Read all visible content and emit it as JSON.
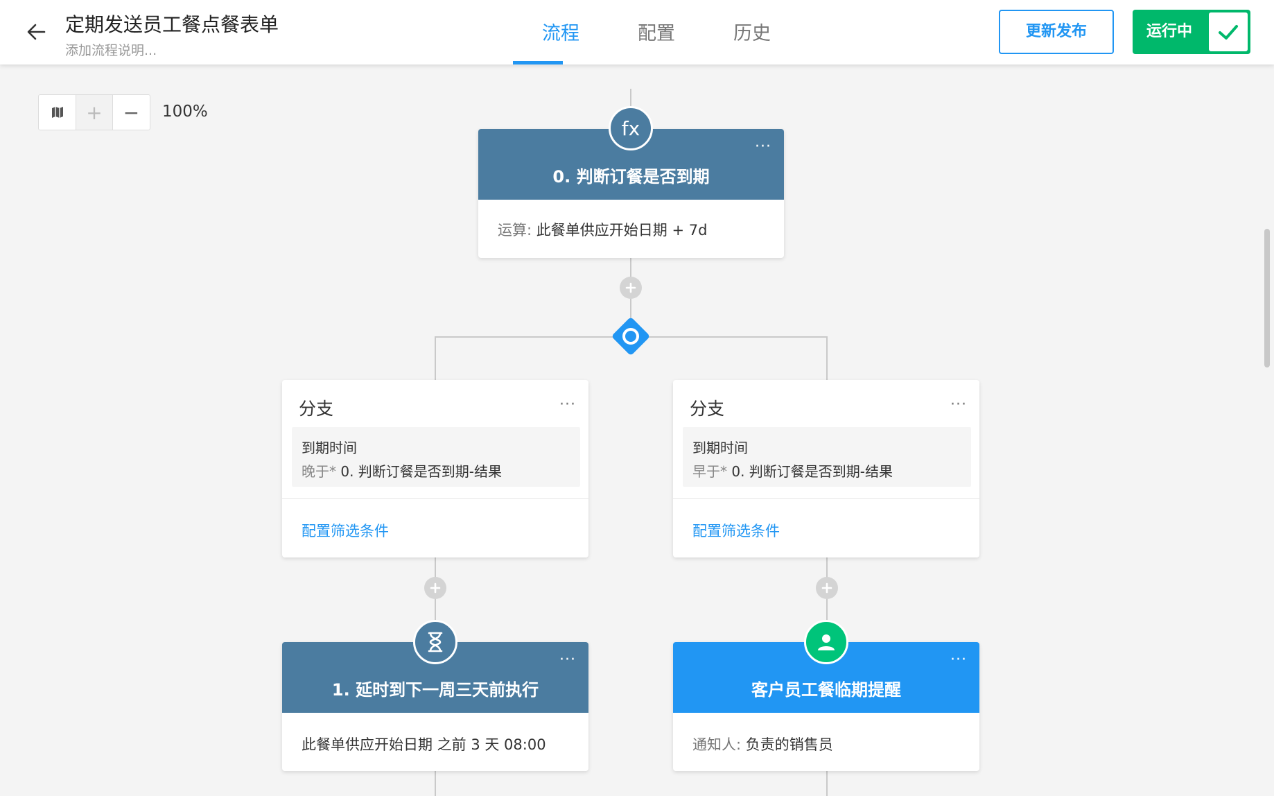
{
  "header": {
    "title": "定期发送员工餐点餐表单",
    "subtitle": "添加流程说明...",
    "tabs": [
      {
        "label": "流程"
      },
      {
        "label": "配置"
      },
      {
        "label": "历史"
      }
    ],
    "update_label": "更新发布",
    "run_label": "运行中"
  },
  "zoom": {
    "level": "100%",
    "plus": "+",
    "minus": "−"
  },
  "nodes": {
    "calc": {
      "icon_text": "fx",
      "title": "0. 判断订餐是否到期",
      "more": "···",
      "label": "运算:",
      "value": "此餐单供应开始日期 + 7d"
    },
    "branch_left": {
      "title": "分支",
      "more": "···",
      "field": "到期时间",
      "op": "晚于*",
      "target": "0. 判断订餐是否到期-结果",
      "link": "配置筛选条件"
    },
    "branch_right": {
      "title": "分支",
      "more": "···",
      "field": "到期时间",
      "op": "早于*",
      "target": "0. 判断订餐是否到期-结果",
      "link": "配置筛选条件"
    },
    "delay": {
      "title": "1. 延时到下一周三天前执行",
      "more": "···",
      "value": "此餐单供应开始日期 之前 3 天 08:00"
    },
    "notify": {
      "title": "客户员工餐临期提醒",
      "more": "···",
      "label": "通知人:",
      "value": "负责的销售员"
    }
  },
  "colors": {
    "accent": "#2196f3",
    "node_dark": "#4b7ca0",
    "success": "#00b86b"
  },
  "icons": {
    "back": "arrow-left-icon",
    "map": "map-icon",
    "check": "check-icon",
    "calc": "function-icon",
    "delay": "hourglass-icon",
    "notify": "user-icon",
    "add": "plus-icon",
    "gateway": "branch-gateway-icon"
  }
}
